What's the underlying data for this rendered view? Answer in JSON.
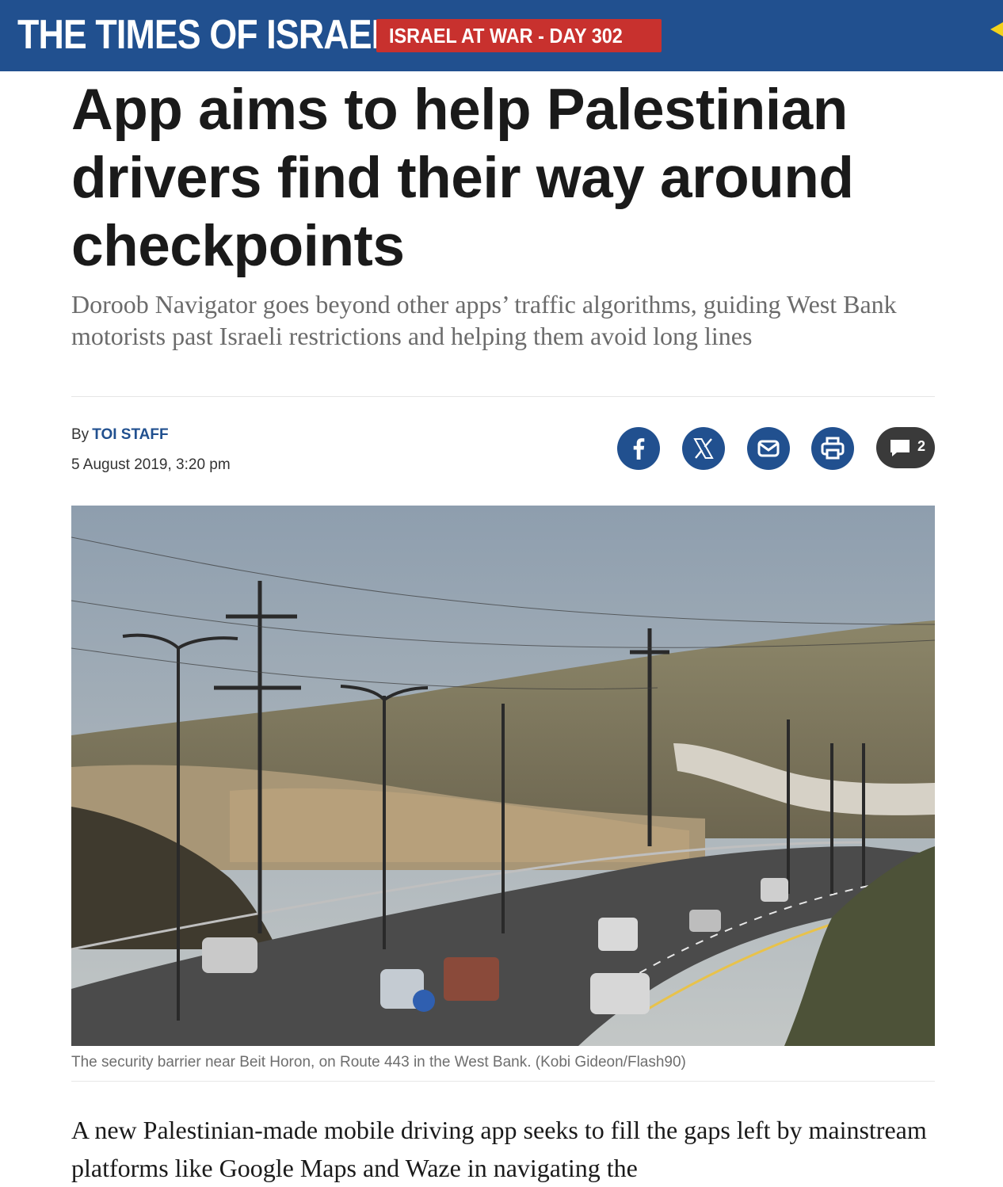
{
  "header": {
    "logo": "THE TIMES OF ISRAEL",
    "badge": "ISRAEL AT WAR - DAY 302",
    "brand_color": "#21508f",
    "badge_color": "#c8312e"
  },
  "article": {
    "headline": "App aims to help Palestinian drivers find their way around checkpoints",
    "subheadline": "Doroob Navigator goes beyond other apps’ traffic algorithms, guiding West Bank motorists past Israeli restrictions and helping them avoid long lines",
    "byline_prefix": "By",
    "author": "TOI STAFF",
    "date": "5 August 2019, 3:20 pm",
    "caption": "The security barrier near Beit Horon, on Route 443 in the West Bank. (Kobi Gideon/Flash90)",
    "body_first": "A new Palestinian-made mobile driving app seeks to fill the gaps left by mainstream platforms like Google Maps and Waze in navigating the"
  },
  "share": {
    "icons": [
      "facebook-icon",
      "x-icon",
      "email-icon",
      "print-icon",
      "comment-icon"
    ],
    "comment_count": "2"
  }
}
